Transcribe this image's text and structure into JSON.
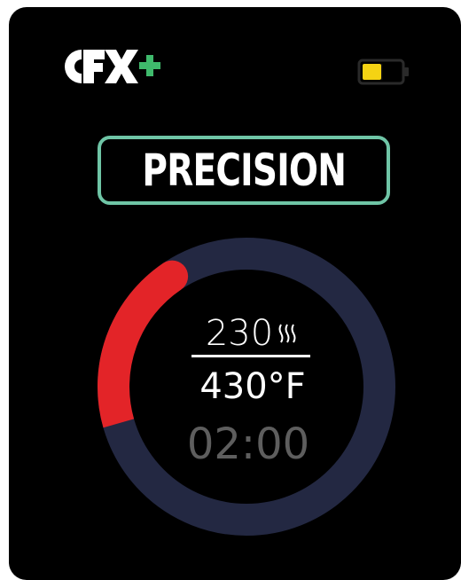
{
  "brand": {
    "logo_text": "CFX+",
    "logo_color": "#ffffff",
    "plus_color": "#3fba6c"
  },
  "battery": {
    "level": 0.5,
    "fill_color": "#f5d313",
    "icon": "battery-icon"
  },
  "mode": {
    "label": "PRECISION",
    "border_color": "#6fc5a6"
  },
  "dial": {
    "progress": 0.2,
    "progress_color": "#e32428",
    "track_color": "#232842"
  },
  "readout": {
    "current_temp": "230",
    "heating_icon": "heating-waves-icon",
    "target_temp": "430°F",
    "timer": "02:00"
  }
}
